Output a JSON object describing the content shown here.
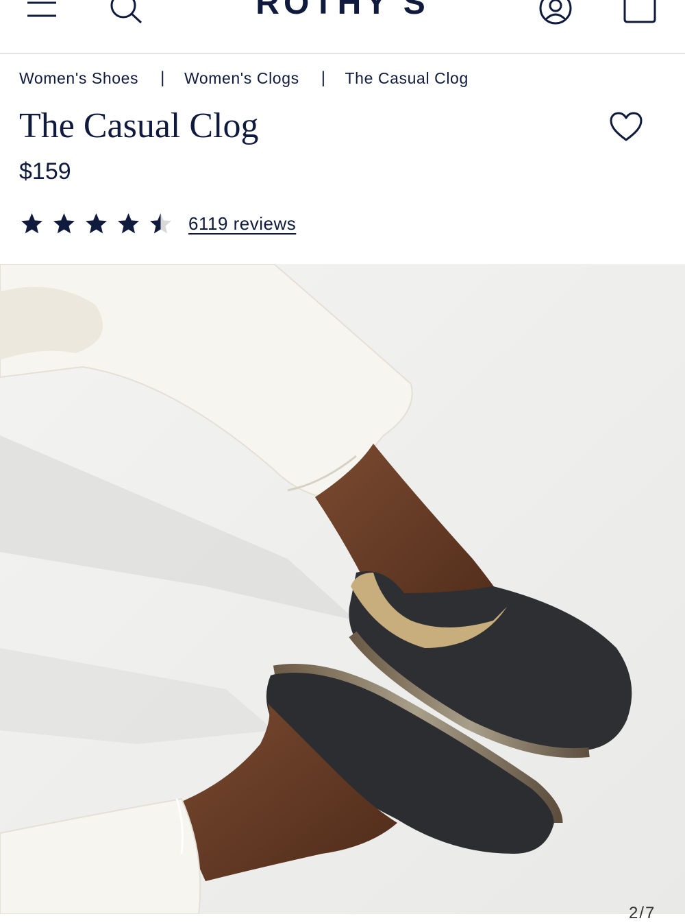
{
  "header": {
    "logo": "ROTHY'S",
    "icons": [
      "menu-icon",
      "search-icon",
      "account-icon",
      "bag-icon"
    ]
  },
  "breadcrumb": {
    "items": [
      "Women's Shoes",
      "Women's Clogs",
      "The Casual Clog"
    ],
    "separator": "|"
  },
  "product": {
    "title": "The Casual Clog",
    "price": "$159",
    "rating": 4.5,
    "reviews_label": "6119 reviews",
    "favorite_icon": "heart-icon"
  },
  "gallery": {
    "counter": "2/7"
  },
  "colors": {
    "navy": "#0f1a3c",
    "divider": "#e2e2e2",
    "image_background": "#eeeeec"
  }
}
